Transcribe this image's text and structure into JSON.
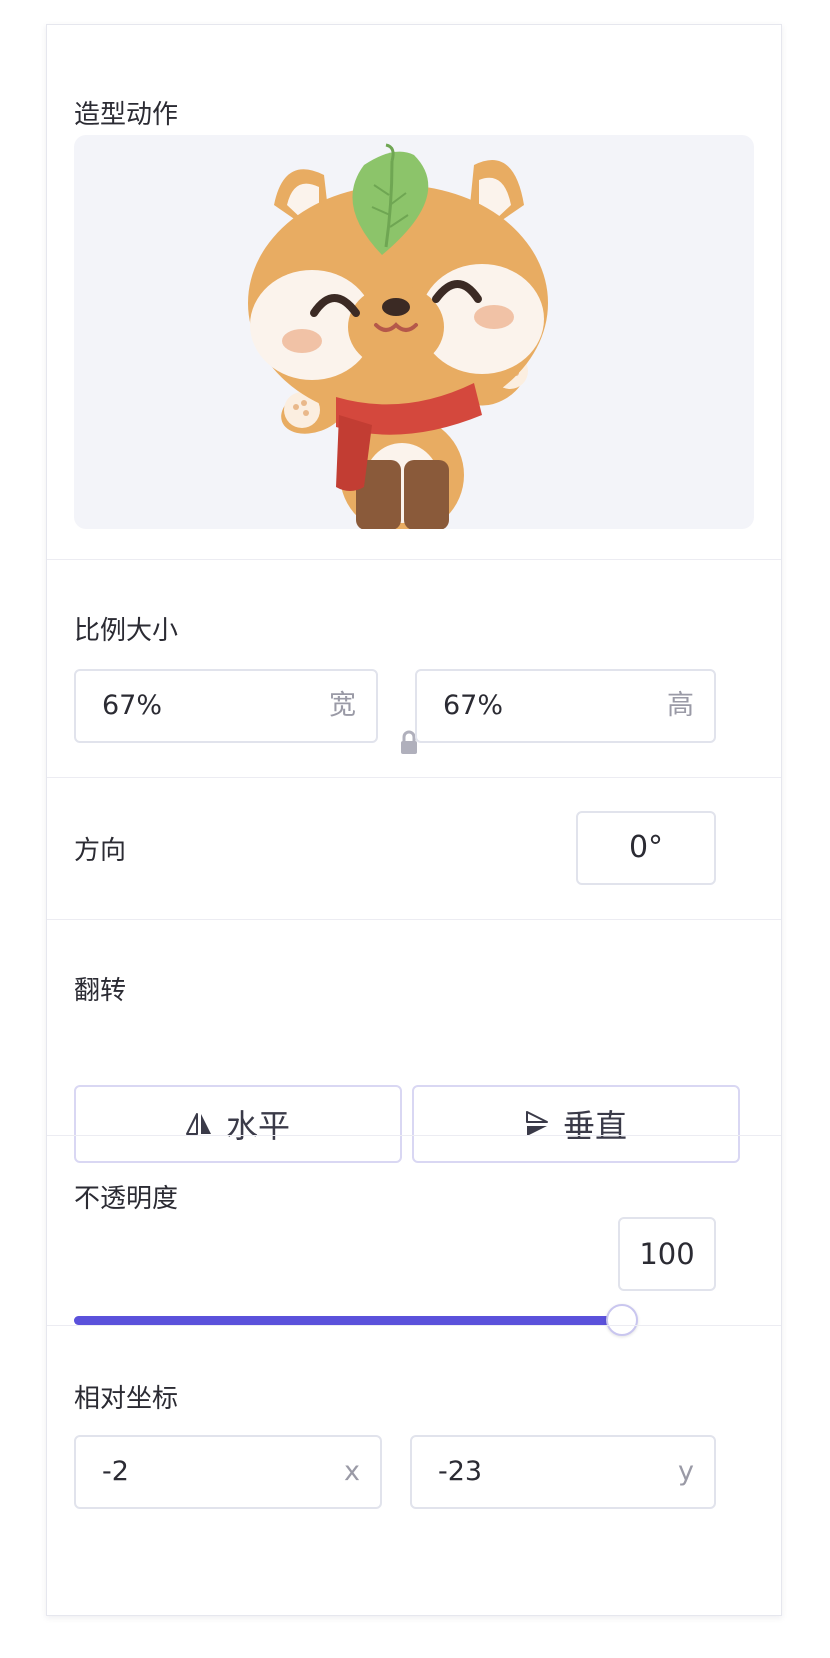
{
  "costume": {
    "title": "造型动作",
    "image_alt": "fox-mascot"
  },
  "scale": {
    "title": "比例大小",
    "width_value": "67%",
    "width_unit": "宽",
    "height_value": "67%",
    "height_unit": "高"
  },
  "direction": {
    "title": "方向",
    "value": "0°"
  },
  "flip": {
    "title": "翻转",
    "horizontal_label": "水平",
    "vertical_label": "垂直"
  },
  "opacity": {
    "title": "不透明度",
    "value": "100",
    "level": 1.0
  },
  "position": {
    "title": "相对坐标",
    "x_value": "-2",
    "x_unit": "x",
    "y_value": "-23",
    "y_unit": "y"
  },
  "colors": {
    "accent": "#5b51db",
    "border": "#e1e3ec",
    "preview_bg": "#f3f4f9"
  }
}
